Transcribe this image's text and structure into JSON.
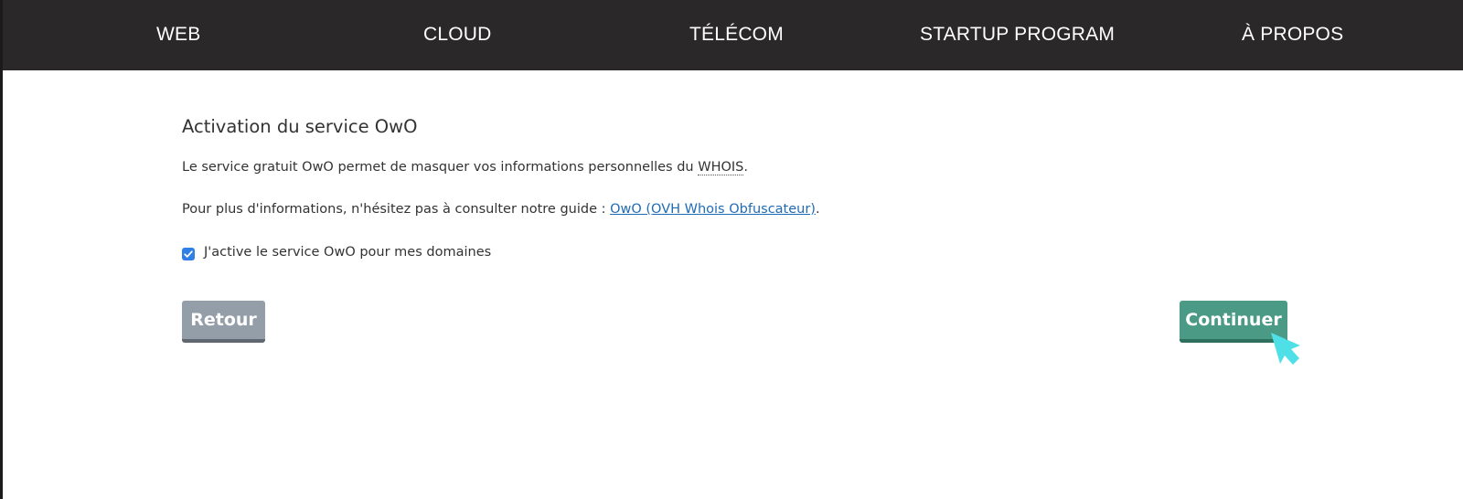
{
  "nav": {
    "items": [
      {
        "label": "WEB"
      },
      {
        "label": "CLOUD"
      },
      {
        "label": "TÉLÉCOM"
      },
      {
        "label": "STARTUP PROGRAM"
      },
      {
        "label": "À PROPOS"
      }
    ]
  },
  "main": {
    "title": "Activation du service OwO",
    "description_prefix": "Le service gratuit OwO permet de masquer vos informations personnelles du ",
    "whois_abbr": "WHOIS",
    "description_suffix": ".",
    "info_prefix": "Pour plus d'informations, n'hésitez pas à consulter notre guide : ",
    "guide_link": "OwO (OVH Whois Obfuscateur)",
    "info_suffix": ".",
    "checkbox_label": "J'active le service OwO pour mes domaines",
    "checkbox_checked": true
  },
  "buttons": {
    "back_label": "Retour",
    "continue_label": "Continuer"
  },
  "colors": {
    "nav_background": "#2a2828",
    "back_button": "#939ea9",
    "continue_button": "#4b9a85",
    "link": "#1f6bb5",
    "checkbox": "#2f7fe6",
    "cursor": "#4ee0e6"
  },
  "icons": {
    "checkbox": "checkmark-icon",
    "cursor": "pointer-cursor-icon"
  }
}
